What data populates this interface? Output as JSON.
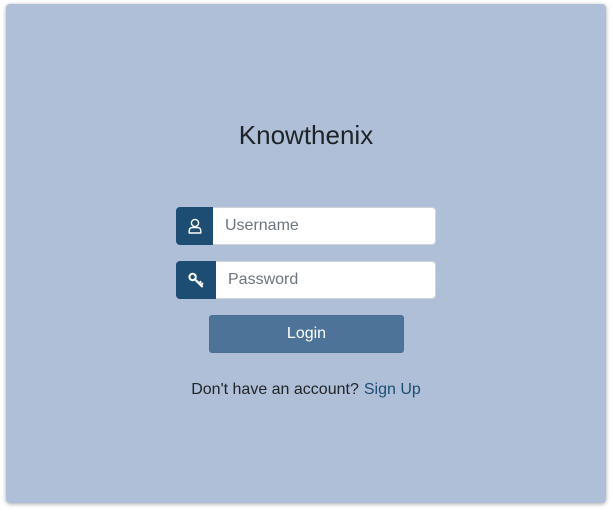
{
  "app": {
    "title": "Knowthenix"
  },
  "login_form": {
    "username_placeholder": "Username",
    "username_value": "",
    "password_placeholder": "Password",
    "password_value": "",
    "login_label": "Login"
  },
  "signup": {
    "prompt": "Don't have an account?",
    "link_label": "Sign Up"
  },
  "icons": {
    "username": "user-icon",
    "password": "key-icon"
  },
  "colors": {
    "background": "#afbfd8",
    "addon": "#1e4d74",
    "button": "#4d7498",
    "link": "#1e4d74"
  }
}
